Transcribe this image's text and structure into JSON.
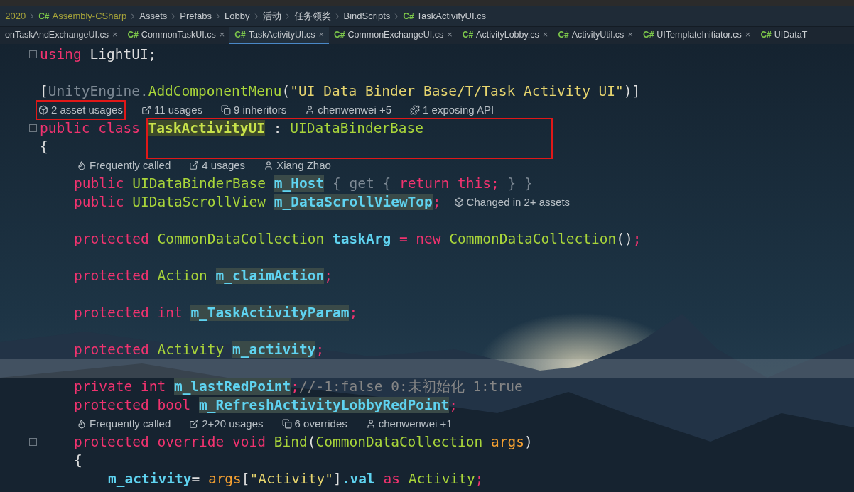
{
  "breadcrumb": [
    {
      "text": "_2020",
      "kind": "project"
    },
    {
      "text": "Assembly-CSharp",
      "kind": "project",
      "icon": "C#"
    },
    {
      "text": "Assets",
      "kind": "folder"
    },
    {
      "text": "Prefabs",
      "kind": "folder"
    },
    {
      "text": "Lobby",
      "kind": "folder"
    },
    {
      "text": "活动",
      "kind": "folder"
    },
    {
      "text": "任务领奖",
      "kind": "folder"
    },
    {
      "text": "BindScripts",
      "kind": "folder"
    },
    {
      "text": "TaskActivityUI.cs",
      "kind": "file",
      "icon": "C#"
    }
  ],
  "tabs": [
    {
      "label": "onTaskAndExchangeUI.cs",
      "close": "×",
      "selected": false
    },
    {
      "icon": "C#",
      "label": "CommonTaskUI.cs",
      "close": "×",
      "selected": false
    },
    {
      "icon": "C#",
      "label": "TaskActivityUI.cs",
      "close": "×",
      "selected": true
    },
    {
      "icon": "C#",
      "label": "CommonExchangeUI.cs",
      "close": "×",
      "selected": false
    },
    {
      "icon": "C#",
      "label": "ActivityLobby.cs",
      "close": "×",
      "selected": false
    },
    {
      "icon": "C#",
      "label": "ActivityUtil.cs",
      "close": "×",
      "selected": false
    },
    {
      "icon": "C#",
      "label": "UITemplateInitiator.cs",
      "close": "×",
      "selected": false
    },
    {
      "icon": "C#",
      "label": "UIDataT",
      "selected": false
    }
  ],
  "lines": [
    {
      "kind": "code",
      "fold": true,
      "tokens": [
        {
          "kind": "kw",
          "text": "using"
        },
        {
          "kind": "punct",
          "text": " LightUI;"
        }
      ]
    },
    {
      "kind": "empty"
    },
    {
      "kind": "code",
      "tokens": [
        {
          "kind": "punct",
          "text": "["
        },
        {
          "kind": "dim",
          "text": "UnityEngine."
        },
        {
          "kind": "type",
          "text": "AddComponentMenu"
        },
        {
          "kind": "punct",
          "text": "("
        },
        {
          "kind": "str",
          "text": "\"UI Data Binder Base/T/Task Activity UI\""
        },
        {
          "kind": "punct",
          "text": ")]"
        }
      ]
    },
    {
      "kind": "hints",
      "items": [
        {
          "kind": "unity",
          "text": "2 asset usages",
          "framed": true
        },
        {
          "kind": "usages",
          "text": "11 usages",
          "framed": false
        },
        {
          "kind": "inheritors",
          "text": "9 inheritors",
          "framed": false
        },
        {
          "kind": "user",
          "text": "chenwenwei +5",
          "framed": false
        },
        {
          "kind": "api",
          "text": "1 exposing API",
          "framed": false
        }
      ]
    },
    {
      "kind": "code",
      "fold": true,
      "framed": true,
      "tokens": [
        {
          "kind": "kw",
          "text": "public class "
        },
        {
          "kind": "decl",
          "text": "TaskActivityUI",
          "hl": true
        },
        {
          "kind": "punct",
          "text": " : "
        },
        {
          "kind": "type",
          "text": "UIDataBinderBase"
        }
      ]
    },
    {
      "kind": "code",
      "tokens": [
        {
          "kind": "punct",
          "text": "{"
        }
      ],
      "children": [
        {
          "kind": "hints",
          "items": [
            {
              "kind": "fire",
              "text": "Frequently called",
              "framed": false
            },
            {
              "kind": "usages",
              "text": "4 usages",
              "framed": false
            },
            {
              "kind": "user",
              "text": "Xiang Zhao",
              "framed": false
            }
          ]
        },
        {
          "kind": "code",
          "tokens": [
            {
              "kind": "kw",
              "text": "public "
            },
            {
              "kind": "type",
              "text": "UIDataBinderBase "
            },
            {
              "kind": "field",
              "text": "m_Host",
              "hl": true
            },
            {
              "kind": "dim",
              "text": " { get { "
            },
            {
              "kind": "kw",
              "text": "return this;"
            },
            {
              "kind": "dim",
              "text": " } }"
            }
          ]
        },
        {
          "kind": "code",
          "tokens": [
            {
              "kind": "kw",
              "text": "public "
            },
            {
              "kind": "type",
              "text": "UIDataScrollView "
            },
            {
              "kind": "field",
              "text": "m_DataScrollViewTop",
              "hl": true
            },
            {
              "kind": "kw",
              "text": ";"
            }
          ],
          "hint": {
            "kind": "unity",
            "text": "Changed in 2+ assets"
          }
        },
        {
          "kind": "empty"
        },
        {
          "kind": "code",
          "tokens": [
            {
              "kind": "kw",
              "text": "protected "
            },
            {
              "kind": "type",
              "text": "CommonDataCollection "
            },
            {
              "kind": "field",
              "text": "taskArg"
            },
            {
              "kind": "kw",
              "text": " = new "
            },
            {
              "kind": "type",
              "text": "CommonDataCollection"
            },
            {
              "kind": "punct",
              "text": "()"
            },
            {
              "kind": "kw",
              "text": ";"
            }
          ]
        },
        {
          "kind": "empty"
        },
        {
          "kind": "code",
          "tokens": [
            {
              "kind": "kw",
              "text": "protected "
            },
            {
              "kind": "type",
              "text": "Action "
            },
            {
              "kind": "field",
              "text": "m_claimAction",
              "hl": true
            },
            {
              "kind": "kw",
              "text": ";"
            }
          ]
        },
        {
          "kind": "empty"
        },
        {
          "kind": "code",
          "tokens": [
            {
              "kind": "kw",
              "text": "protected int "
            },
            {
              "kind": "field",
              "text": "m_TaskActivityParam",
              "hl": true
            },
            {
              "kind": "kw",
              "text": ";"
            }
          ]
        },
        {
          "kind": "empty"
        },
        {
          "kind": "code",
          "tokens": [
            {
              "kind": "kw",
              "text": "protected "
            },
            {
              "kind": "type",
              "text": "Activity "
            },
            {
              "kind": "field",
              "text": "m_activity",
              "hl": true
            },
            {
              "kind": "kw",
              "text": ";"
            }
          ]
        },
        {
          "kind": "empty",
          "current": true
        },
        {
          "kind": "code",
          "tokens": [
            {
              "kind": "kw",
              "text": "private int "
            },
            {
              "kind": "field",
              "text": "m_lastRedPoint",
              "hl": true
            },
            {
              "kind": "kw",
              "text": ";"
            },
            {
              "kind": "comment",
              "text": "//-1:false 0:未初始化 1:true"
            }
          ]
        },
        {
          "kind": "code",
          "tokens": [
            {
              "kind": "kw",
              "text": "protected bool "
            },
            {
              "kind": "field",
              "text": "m_RefreshActivityLobbyRedPoint",
              "hl": true
            },
            {
              "kind": "kw",
              "text": ";"
            }
          ]
        },
        {
          "kind": "hints",
          "items": [
            {
              "kind": "fire",
              "text": "Frequently called",
              "framed": false
            },
            {
              "kind": "usages",
              "text": "2+20 usages",
              "framed": false
            },
            {
              "kind": "overrides",
              "text": "6 overrides",
              "framed": false
            },
            {
              "kind": "user",
              "text": "chenwenwei +1",
              "framed": false
            }
          ]
        },
        {
          "kind": "code",
          "fold": true,
          "tokens": [
            {
              "kind": "kw",
              "text": "protected override void "
            },
            {
              "kind": "type",
              "text": "Bind"
            },
            {
              "kind": "punct",
              "text": "("
            },
            {
              "kind": "type",
              "text": "CommonDataCollection "
            },
            {
              "kind": "param",
              "text": "args"
            },
            {
              "kind": "punct",
              "text": ")"
            }
          ]
        },
        {
          "kind": "code",
          "tokens": [
            {
              "kind": "punct",
              "text": "{"
            }
          ],
          "children": [
            {
              "kind": "code",
              "tokens": [
                {
                  "kind": "field",
                  "text": "m_activity"
                },
                {
                  "kind": "punct",
                  "text": "= "
                },
                {
                  "kind": "param",
                  "text": "args"
                },
                {
                  "kind": "punct",
                  "text": "["
                },
                {
                  "kind": "str",
                  "text": "\"Activity\""
                },
                {
                  "kind": "punct",
                  "text": "]"
                },
                {
                  "kind": "field",
                  "text": ".val"
                },
                {
                  "kind": "kw",
                  "text": " as "
                },
                {
                  "kind": "type",
                  "text": "Activity"
                },
                {
                  "kind": "kw",
                  "text": ";"
                }
              ]
            }
          ]
        }
      ]
    }
  ]
}
